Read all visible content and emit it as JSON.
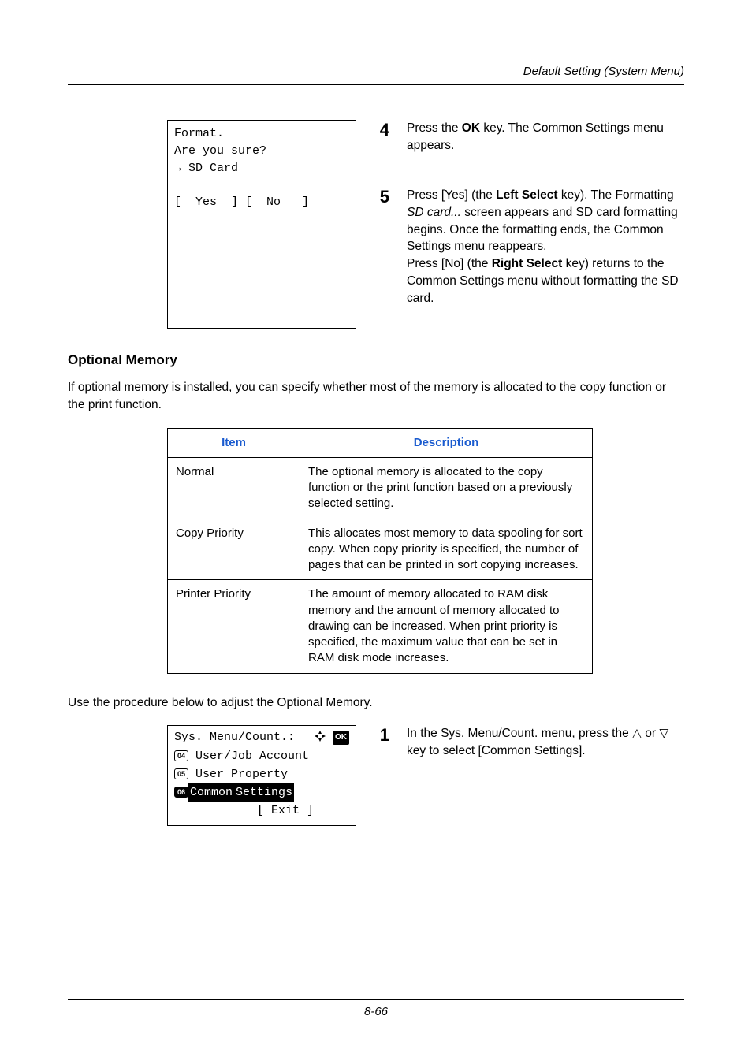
{
  "header": {
    "section_title": "Default Setting (System Menu)"
  },
  "lcd1": {
    "l1": "Format.",
    "l2": "Are you sure?",
    "l3a": "→",
    "l3b": " SD Card",
    "l4": "",
    "l5": "[  Yes  ] [  No   ]"
  },
  "step4": {
    "num": "4",
    "t1": "Press the ",
    "bold1": "OK",
    "t2": " key. The Common Settings menu appears."
  },
  "step5": {
    "num": "5",
    "t1": "Press [Yes] (the ",
    "bold1": "Left Select",
    "t2": " key). The Formatting ",
    "ital1": "SD card...",
    "t3": " screen appears and SD card formatting begins. Once the formatting ends, the Common Settings menu reappears.",
    "t4": "Press [No] (the ",
    "bold2": "Right Select",
    "t5": " key) returns to the Common Settings menu without formatting the SD card."
  },
  "optmem": {
    "heading": "Optional Memory",
    "intro": "If optional memory is installed, you can specify whether most of the memory is allocated to the copy function or the print function.",
    "th_item": "Item",
    "th_desc": "Description",
    "rows": [
      {
        "item": "Normal",
        "desc": "The optional memory is allocated to the copy function or the print function based on a previously selected setting."
      },
      {
        "item": "Copy Priority",
        "desc": "This allocates most memory to data spooling for sort copy. When copy priority is specified, the number of pages that can be printed in sort copying increases."
      },
      {
        "item": "Printer Priority",
        "desc": "The amount of memory allocated to RAM disk memory and the amount of memory allocated to drawing can be increased. When print priority is specified, the maximum value that can be set in RAM disk mode increases."
      }
    ],
    "procedure_intro": "Use the procedure below to adjust the Optional Memory."
  },
  "lcd2": {
    "title": "Sys. Menu/Count.",
    "colon": ":",
    "n1": "04",
    "r1": " User/Job Account",
    "n2": "05",
    "r2": " User Property",
    "n3": "06",
    "r3a": " Common",
    "r3b": " Settings",
    "exit": "[  Exit  ]"
  },
  "step1": {
    "num": "1",
    "t1": "In the Sys. Menu/Count. menu, press the ",
    "tri_up": "△",
    "t2": " or ",
    "tri_dn": "▽",
    "t3": " key to select [Common Settings]."
  },
  "footer": {
    "page": "8-66"
  }
}
